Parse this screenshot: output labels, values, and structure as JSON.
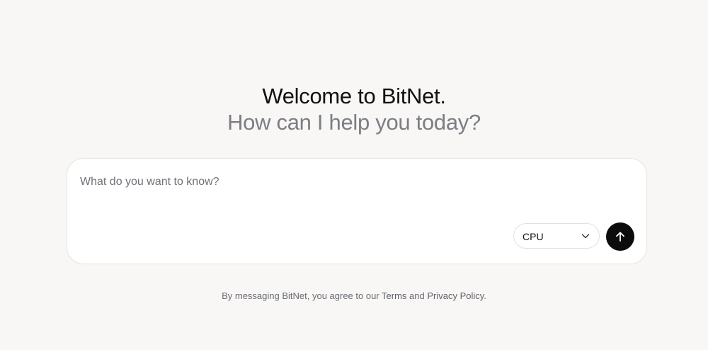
{
  "hero": {
    "title": "Welcome to BitNet.",
    "subtitle": "How can I help you today?"
  },
  "composer": {
    "placeholder": "What do you want to know?",
    "value": "",
    "device_select": {
      "selected": "CPU",
      "icon": "chevron-down-icon"
    },
    "send_button": {
      "icon": "arrow-up-icon",
      "color": "#0c0c0c"
    }
  },
  "footer": {
    "prefix": "By messaging BitNet, you agree to our ",
    "terms_label": "Terms",
    "conjunction": " and ",
    "privacy_label": "Privacy Policy",
    "suffix": "."
  },
  "colors": {
    "page_background": "#f8f7f5",
    "title": "#111111",
    "subtitle": "#7c7e84",
    "composer_background": "#ffffff",
    "composer_border": "#e6e4e0"
  }
}
